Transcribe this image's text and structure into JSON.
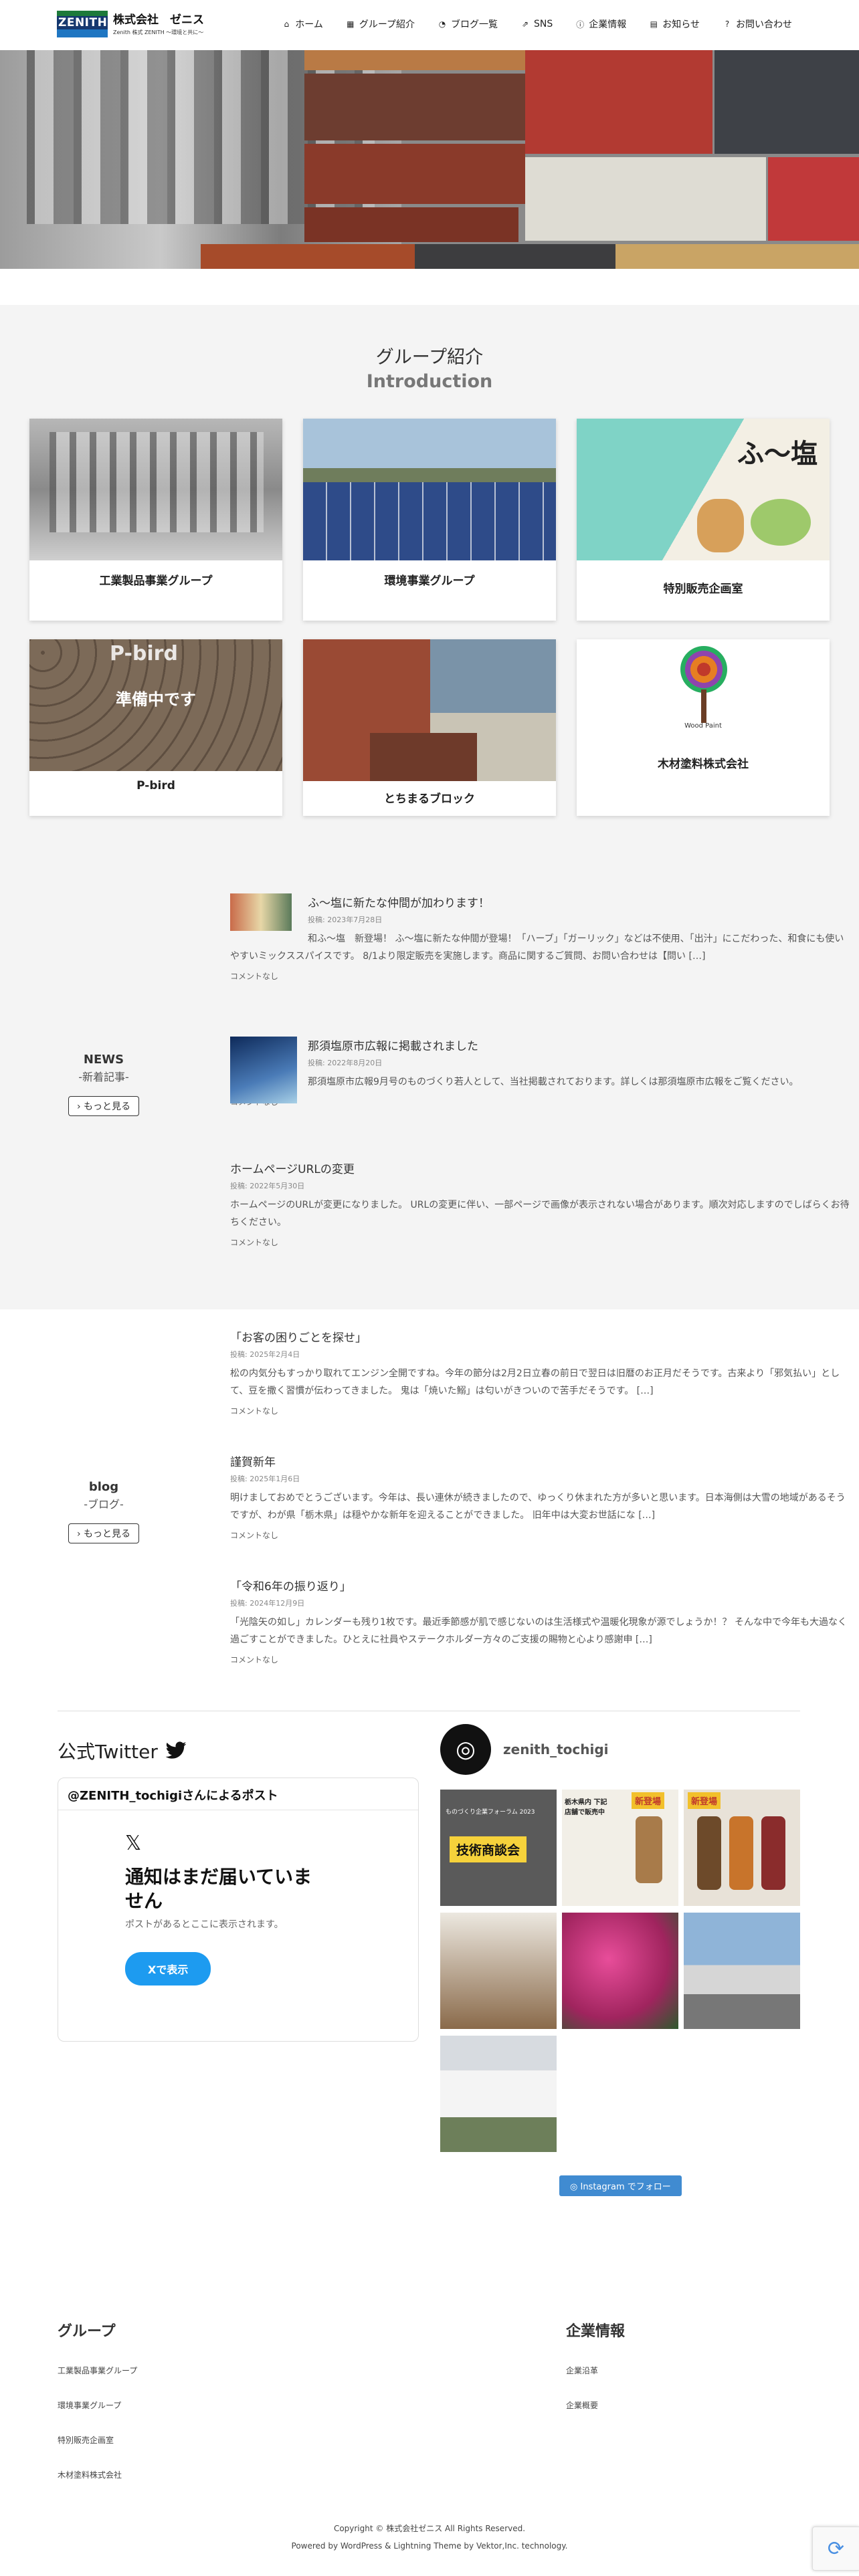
{
  "header": {
    "logo_word": "ZENITH",
    "company_name": "株式会社　ゼニス",
    "tagline": "Zenith 株式 ZENITH ～環境と共に～",
    "nav": [
      {
        "icon": "home-icon",
        "label": "ホーム"
      },
      {
        "icon": "building-icon",
        "label": "グループ紹介"
      },
      {
        "icon": "rss-icon",
        "label": "ブログ一覧"
      },
      {
        "icon": "share-icon",
        "label": "SNS"
      },
      {
        "icon": "info-icon",
        "label": "企業情報"
      },
      {
        "icon": "newspaper-icon",
        "label": "お知らせ"
      },
      {
        "icon": "question-icon",
        "label": "お問い合わせ"
      }
    ]
  },
  "intro": {
    "title": "グループ紹介",
    "subtitle": "Introduction",
    "cards": [
      {
        "label": "工業製品事業グループ"
      },
      {
        "label": "環境事業グループ"
      },
      {
        "label": "特別販売企画室",
        "image_text": "ふ〜塩"
      },
      {
        "label": "P-bird",
        "image_text": "準備中です",
        "image_sign": "P-bird"
      },
      {
        "label": "とちまるブロック"
      },
      {
        "label": "木材塗料株式会社",
        "image_text": "Wood Paint"
      }
    ]
  },
  "news": {
    "title": "NEWS",
    "subtitle": "-新着記事-",
    "more": "もっと見る",
    "posts": [
      {
        "title": "ふ〜塩に新たな仲間が加わります！",
        "date": "投稿: 2023年7月28日",
        "excerpt": "和ふ〜塩　新登場！ ふ〜塩に新たな仲間が登場！「ハーブ」「ガーリック」などは不使用、「出汁」にこだわった、和食にも使いやすいミックススパイスです。 8/1より限定販売を実施します。商品に関するご質問、お問い合わせは【問い […]",
        "comment": "コメントなし"
      },
      {
        "title": "那須塩原市広報に掲載されました",
        "date": "投稿: 2022年8月20日",
        "excerpt": "那須塩原市広報9月号のものづくり若人として、当社掲載されております。詳しくは那須塩原市広報をご覧ください。",
        "comment": "コメントなし"
      },
      {
        "title": "ホームページURLの変更",
        "date": "投稿: 2022年5月30日",
        "excerpt": "ホームページのURLが変更になりました。 URLの変更に伴い、一部ページで画像が表示されない場合があります。順次対応しますのでしばらくお待ちください。",
        "comment": "コメントなし"
      }
    ]
  },
  "blog": {
    "title": "blog",
    "subtitle": "-ブログ-",
    "more": "もっと見る",
    "posts": [
      {
        "title": "「お客の困りごとを探せ」",
        "date": "投稿: 2025年2月4日",
        "excerpt": "松の内気分もすっかり取れてエンジン全開ですね。今年の節分は2月2日立春の前日で翌日は旧暦のお正月だそうです。古来より「邪気払い」として、豆を撒く習慣が伝わってきました。 鬼は「焼いた鰯」は匂いがきついので苦手だそうです。 […]",
        "comment": "コメントなし"
      },
      {
        "title": "謹賀新年",
        "date": "投稿: 2025年1月6日",
        "excerpt": "明けましておめでとうございます。今年は、長い連休が続きましたので、ゆっくり休まれた方が多いと思います。日本海側は大雪の地域があるそうですが、わが県「栃木県」は穏やかな新年を迎えることができました。 旧年中は大変お世話にな […]",
        "comment": "コメントなし"
      },
      {
        "title": "「令和6年の振り返り」",
        "date": "投稿: 2024年12月9日",
        "excerpt": "「光陰矢の如し」カレンダーも残り1枚です。最近季節感が肌で感じないのは生活様式や温暖化現象が源でしょうか！？ そんな中で今年も大過なく過ごすことができました。ひとえに社員やステークホルダー方々のご支援の賜物と心より感謝申 […]",
        "comment": "コメントなし"
      }
    ]
  },
  "twitter": {
    "title": "公式Twitter",
    "widget_header": "@ZENITH_tochigiさんによるポスト",
    "empty_title": "通知はまだ届いていません",
    "empty_sub": "ポストがあるとここに表示されます。",
    "button": "Xで表示"
  },
  "instagram": {
    "username": "zenith_tochigi",
    "follow": "Instagram でフォロー",
    "tiles": [
      {
        "caption": "技術商談会",
        "subcaption": "ものづくり企業フォーラム 2023"
      },
      {
        "caption": "新登場",
        "subcaption": "栃木県内 下記店舗で販売中"
      },
      {
        "caption": "新登場"
      },
      {
        "caption": ""
      },
      {
        "caption": ""
      },
      {
        "caption": ""
      },
      {
        "caption": ""
      }
    ]
  },
  "footer": {
    "group_title": "グループ",
    "group_links": [
      "工業製品事業グループ",
      "環境事業グループ",
      "特別販売企画室",
      "木材塗料株式会社"
    ],
    "company_title": "企業情報",
    "company_links": [
      "企業沿革",
      "企業概要"
    ],
    "copyright": "Copyright © 株式会社ゼニス All Rights Reserved.",
    "powered": "Powered by WordPress & Lightning Theme by Vektor,Inc. technology."
  },
  "colors": {
    "twitter_blue": "#1d9bf0",
    "instagram_button": "#408bd1",
    "section_bg": "#f4f4f4"
  }
}
